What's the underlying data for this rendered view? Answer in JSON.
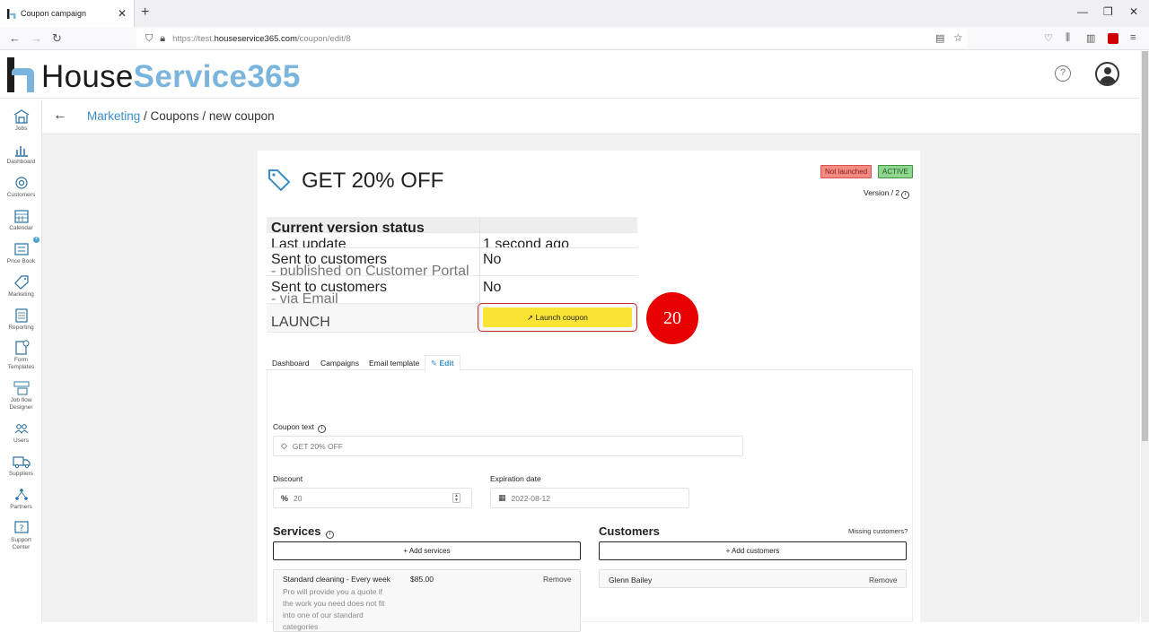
{
  "browser": {
    "tab_title": "Coupon campaign",
    "url_prefix": "https://test.",
    "url_domain": "houseservice365.com",
    "url_path": "/coupon/edit/8"
  },
  "header": {
    "brand_house": "House",
    "brand_service": "Service365",
    "help": "?"
  },
  "sidebar": {
    "items": [
      {
        "label": "Jobs"
      },
      {
        "label": "Dashboard"
      },
      {
        "label": "Customers"
      },
      {
        "label": "Calendar"
      },
      {
        "label": "Price Book"
      },
      {
        "label": "Marketing"
      },
      {
        "label": "Reporting"
      },
      {
        "label": "Form Templates"
      },
      {
        "label": "Job flow Designer"
      },
      {
        "label": "Users"
      },
      {
        "label": "Suppliers"
      },
      {
        "label": "Partners"
      },
      {
        "label": "Support Center"
      }
    ]
  },
  "breadcrumb": {
    "link": "Marketing",
    "rest": " / Coupons / new coupon"
  },
  "coupon": {
    "title": "GET 20% OFF",
    "badge_not_launched": "Not launched",
    "badge_active": "ACTIVE",
    "version": "Version / 2"
  },
  "status": {
    "header": "Current version status",
    "rows": [
      {
        "label": "Last update",
        "sub": "",
        "value": "1 second ago"
      },
      {
        "label": "Sent to customers",
        "sub": "- published on Customer Portal",
        "value": "No"
      },
      {
        "label": "Sent to customers",
        "sub": "- via Email",
        "value": "No"
      },
      {
        "label": "LAUNCH",
        "sub": "",
        "value": ""
      }
    ],
    "launch_button": "Launch coupon"
  },
  "step_badge": "20",
  "tabs": [
    "Dashboard",
    "Campaigns",
    "Email template",
    "Edit"
  ],
  "form": {
    "coupon_text_label": "Coupon text",
    "coupon_text_value": "GET 20% OFF",
    "discount_label": "Discount",
    "discount_value": "20",
    "expiration_label": "Expiration date",
    "expiration_value": "2022-08-12"
  },
  "services": {
    "title": "Services",
    "add_button": "+ Add services",
    "items": [
      {
        "name": "Standard cleaning - Every week",
        "description": "Pro will provide you a quote if the work you need does not fit into one of our standard categories",
        "price": "$85.00",
        "remove": "Remove"
      }
    ]
  },
  "customers": {
    "title": "Customers",
    "missing_link": "Missing customers?",
    "add_button": "+ Add customers",
    "items": [
      {
        "name": "Glenn Bailey",
        "remove": "Remove"
      }
    ]
  },
  "colors": {
    "accent_blue": "#3a8dc9",
    "launch_yellow": "#f9e333",
    "badge_red": "#e80000",
    "not_launched_bg": "#f28b82",
    "active_bg": "#8fd48f"
  }
}
